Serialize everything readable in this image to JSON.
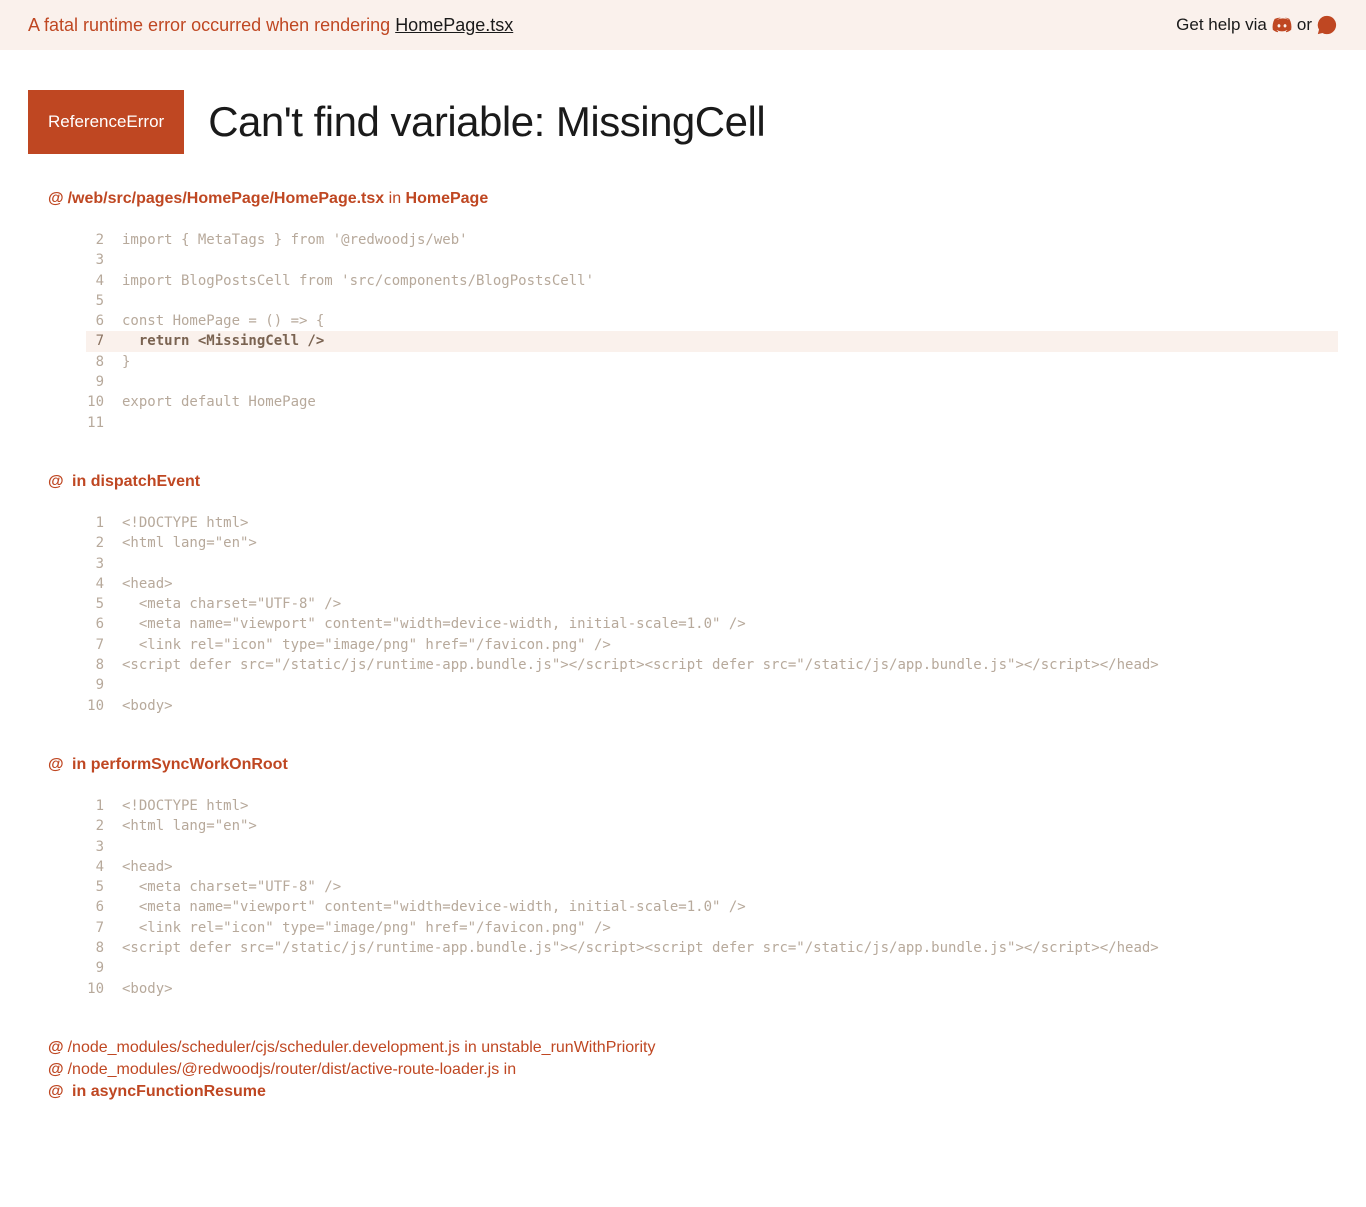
{
  "banner": {
    "prefix": "A fatal runtime error occurred when rendering ",
    "file": "HomePage.tsx",
    "help_text": "Get help via",
    "or": " or "
  },
  "error": {
    "type": "ReferenceError",
    "message": "Can't find variable: MissingCell"
  },
  "frames": [
    {
      "path": "/web/src/pages/HomePage/HomePage.tsx",
      "in_label": " in ",
      "func": "HomePage",
      "highlight": 7,
      "lines": [
        {
          "n": 2,
          "t": "import { MetaTags } from '@redwoodjs/web'"
        },
        {
          "n": 3,
          "t": ""
        },
        {
          "n": 4,
          "t": "import BlogPostsCell from 'src/components/BlogPostsCell'"
        },
        {
          "n": 5,
          "t": ""
        },
        {
          "n": 6,
          "t": "const HomePage = () => {"
        },
        {
          "n": 7,
          "t": "  return <MissingCell />"
        },
        {
          "n": 8,
          "t": "}"
        },
        {
          "n": 9,
          "t": ""
        },
        {
          "n": 10,
          "t": "export default HomePage"
        },
        {
          "n": 11,
          "t": ""
        }
      ]
    },
    {
      "path": "",
      "in_label": " in ",
      "func": "dispatchEvent",
      "highlight": null,
      "lines": [
        {
          "n": 1,
          "t": "<!DOCTYPE html>"
        },
        {
          "n": 2,
          "t": "<html lang=\"en\">"
        },
        {
          "n": 3,
          "t": ""
        },
        {
          "n": 4,
          "t": "<head>"
        },
        {
          "n": 5,
          "t": "  <meta charset=\"UTF-8\" />"
        },
        {
          "n": 6,
          "t": "  <meta name=\"viewport\" content=\"width=device-width, initial-scale=1.0\" />"
        },
        {
          "n": 7,
          "t": "  <link rel=\"icon\" type=\"image/png\" href=\"/favicon.png\" />"
        },
        {
          "n": 8,
          "t": "<script defer src=\"/static/js/runtime-app.bundle.js\"></script><script defer src=\"/static/js/app.bundle.js\"></script></head>"
        },
        {
          "n": 9,
          "t": ""
        },
        {
          "n": 10,
          "t": "<body>"
        }
      ]
    },
    {
      "path": "",
      "in_label": " in ",
      "func": "performSyncWorkOnRoot",
      "highlight": null,
      "lines": [
        {
          "n": 1,
          "t": "<!DOCTYPE html>"
        },
        {
          "n": 2,
          "t": "<html lang=\"en\">"
        },
        {
          "n": 3,
          "t": ""
        },
        {
          "n": 4,
          "t": "<head>"
        },
        {
          "n": 5,
          "t": "  <meta charset=\"UTF-8\" />"
        },
        {
          "n": 6,
          "t": "  <meta name=\"viewport\" content=\"width=device-width, initial-scale=1.0\" />"
        },
        {
          "n": 7,
          "t": "  <link rel=\"icon\" type=\"image/png\" href=\"/favicon.png\" />"
        },
        {
          "n": 8,
          "t": "<script defer src=\"/static/js/runtime-app.bundle.js\"></script><script defer src=\"/static/js/app.bundle.js\"></script></head>"
        },
        {
          "n": 9,
          "t": ""
        },
        {
          "n": 10,
          "t": "<body>"
        }
      ]
    }
  ],
  "collapsed": [
    {
      "path": "/node_modules/scheduler/cjs/scheduler.development.js",
      "in_label": " in ",
      "func": "unstable_runWithPriority"
    },
    {
      "path": "/node_modules/@redwoodjs/router/dist/active-route-loader.js",
      "in_label": " in ",
      "func": ""
    },
    {
      "path": "",
      "in_label": " in ",
      "func": "asyncFunctionResume"
    }
  ]
}
